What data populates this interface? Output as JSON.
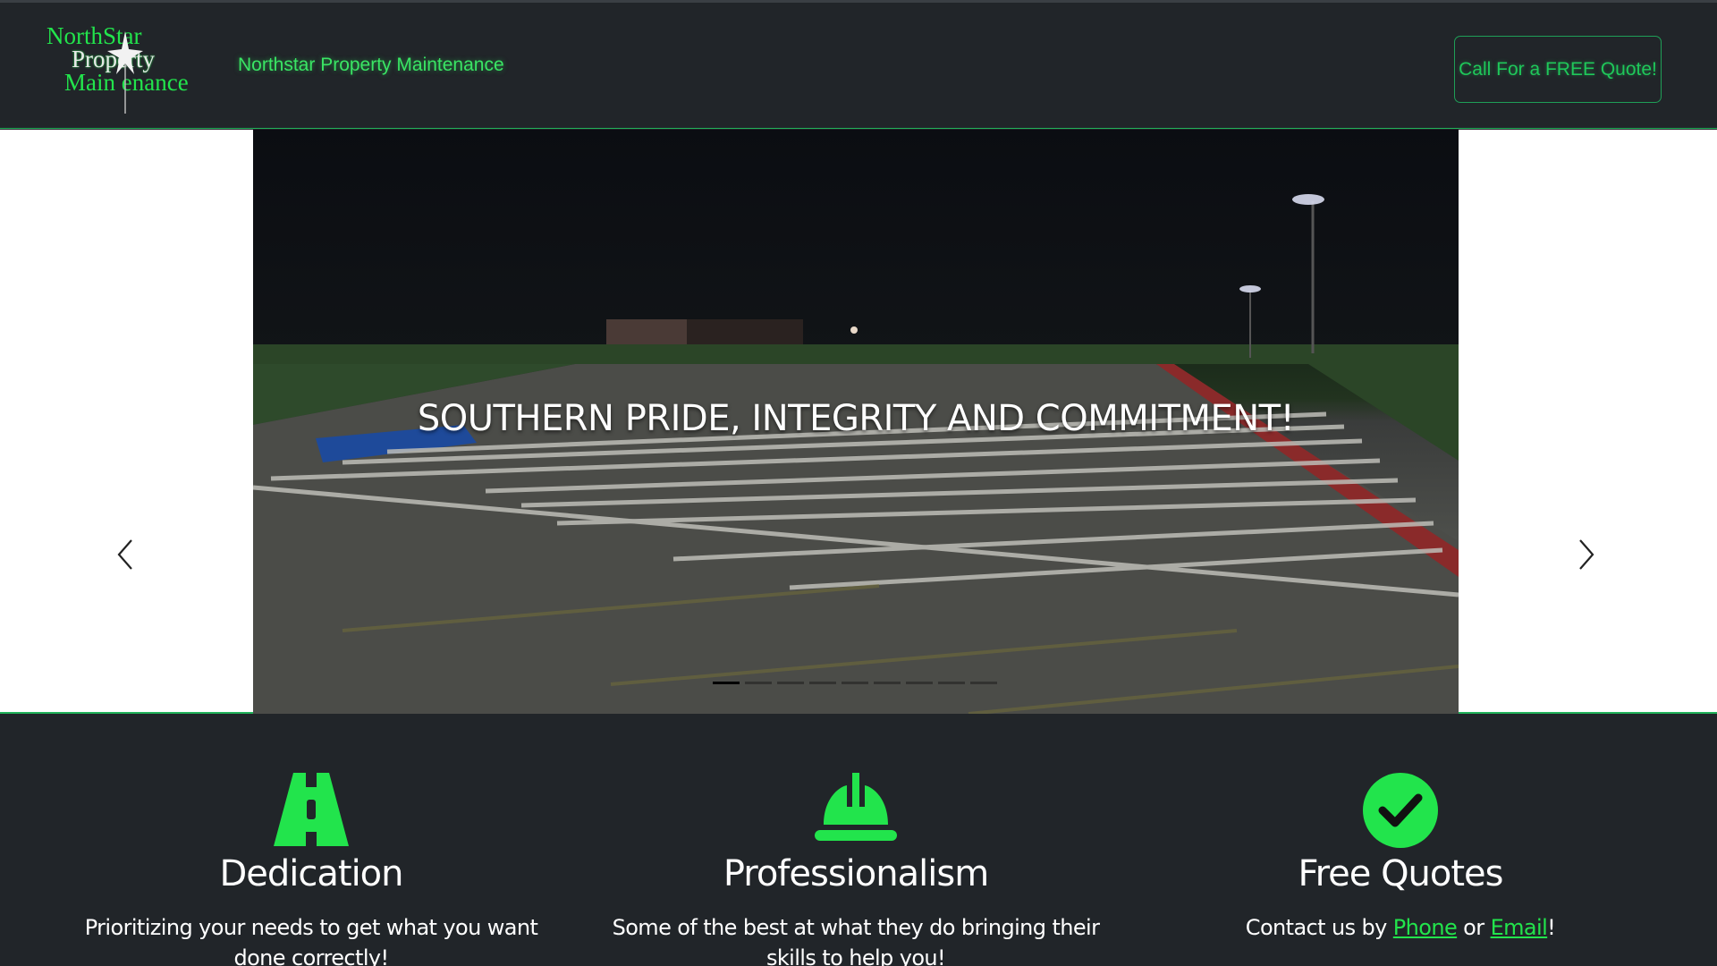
{
  "navbar": {
    "logo_lines": [
      "NorthStar",
      "Property",
      "Main enance"
    ],
    "brand": "Northstar Property Maintenance",
    "quote_button": "Call For a FREE Quote!"
  },
  "carousel": {
    "caption": "SOUTHERN PRIDE, INTEGRITY AND COMMITMENT!",
    "slide_count": 9,
    "active_index": 0,
    "prev_icon": "chevron-left-icon",
    "next_icon": "chevron-right-icon"
  },
  "features": [
    {
      "icon": "road-icon",
      "title": "Dedication",
      "text": "Prioritizing your needs to get what you want done correctly!"
    },
    {
      "icon": "hard-hat-icon",
      "title": "Professionalism",
      "text": "Some of the best at what they do bringing their skills to help you!"
    },
    {
      "icon": "check-circle-icon",
      "title": "Free Quotes",
      "text_before": "Contact us by ",
      "link_phone": "Phone",
      "text_middle": " or ",
      "link_email": "Email",
      "text_after": "!"
    }
  ],
  "colors": {
    "accent_green": "#22e44c",
    "navbar_bg": "#212529",
    "border_green": "#21b35a"
  }
}
